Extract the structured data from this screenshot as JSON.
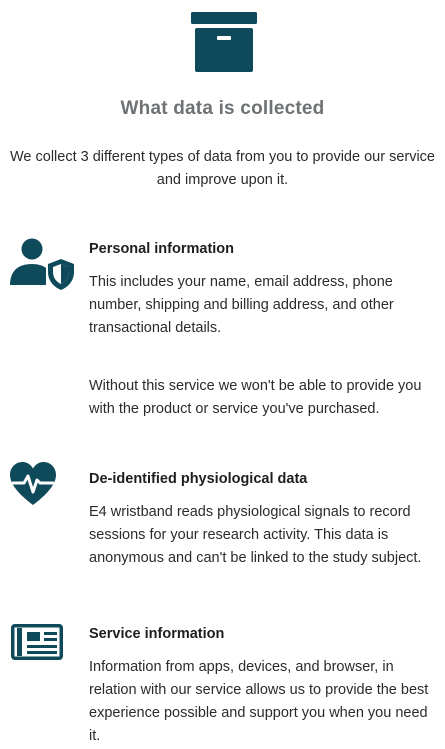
{
  "header": {
    "icon": "archive-box-icon",
    "title": "What data is collected",
    "intro": "We collect 3 different types of data from you to provide our service and improve upon it."
  },
  "sections": [
    {
      "icon": "user-shield-icon",
      "heading": "Personal information",
      "paragraphs": [
        "This includes your name, email address, phone number, shipping and billing address, and other transactional details.",
        "Without this service we won't be able to provide you with the product or service you've purchased."
      ]
    },
    {
      "icon": "heart-pulse-icon",
      "heading": "De-identified physiological data",
      "paragraphs": [
        "E4 wristband reads physiological signals to record sessions for your research activity. This data is anonymous and can't be linked to the study subject."
      ]
    },
    {
      "icon": "newspaper-icon",
      "heading": "Service information",
      "paragraphs": [
        "Information from apps, devices, and browser, in relation with our service allows us to provide the best experience possible and support you when you need it."
      ]
    }
  ],
  "colors": {
    "icon": "#0f4a5b",
    "title": "#6e7274",
    "text": "#2b2b2b"
  }
}
